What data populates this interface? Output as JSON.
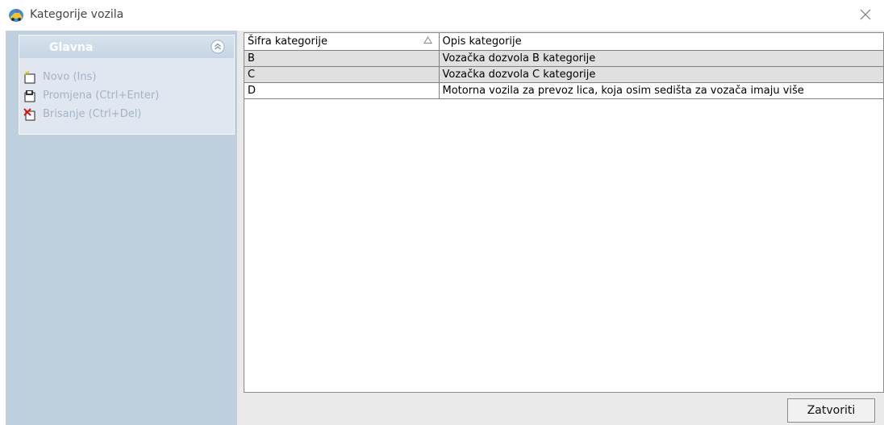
{
  "window": {
    "title": "Kategorije vozila",
    "app_icon": "vehicle-app-icon",
    "close_icon": "close-icon"
  },
  "sidebar": {
    "panel_title": "Glavna",
    "collapse_icon": "chevron-up-double-icon",
    "items": [
      {
        "label": "Novo (Ins)",
        "icon": "new-document-icon"
      },
      {
        "label": "Promjena (Ctrl+Enter)",
        "icon": "edit-document-icon"
      },
      {
        "label": "Brisanje (Ctrl+Del)",
        "icon": "delete-document-icon"
      }
    ]
  },
  "grid": {
    "columns": [
      "Šifra kategorije",
      "Opis kategorije"
    ],
    "sort_icon": "sort-ascending-icon",
    "rows": [
      {
        "code": "B",
        "description": "Vozačka dozvola B kategorije",
        "selected": true
      },
      {
        "code": "C",
        "description": "Vozačka dozvola C kategorije",
        "selected": true
      },
      {
        "code": "D",
        "description": "Motorna vozila za prevoz lica, koja osim sedišta za vozača imaju više",
        "selected": false
      }
    ]
  },
  "footer": {
    "close_label": "Zatvoriti"
  },
  "colors": {
    "sidebar_bg": "#c0cfdd",
    "panel_bg": "#e1e7f0",
    "item_text": "#a3b4c6",
    "selected_row": "#e0e0e0"
  }
}
